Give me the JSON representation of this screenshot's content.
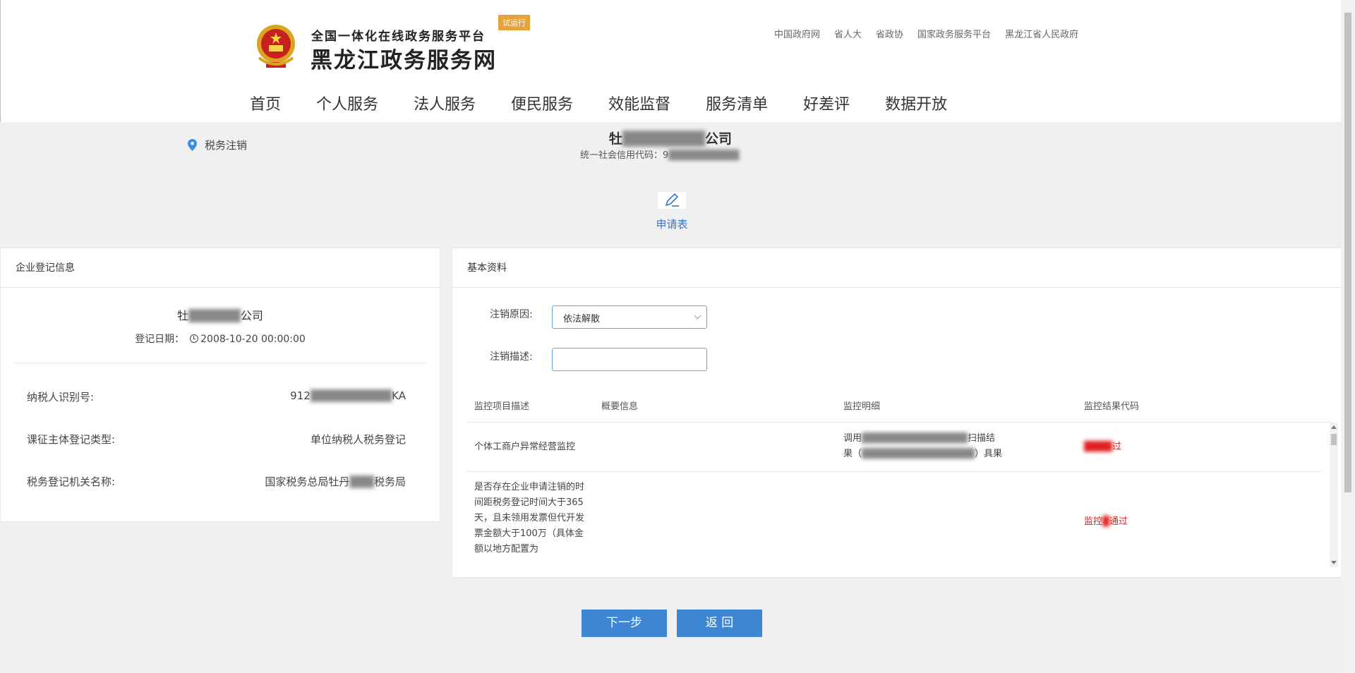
{
  "header": {
    "subtitle": "全国一体化在线政务服务平台",
    "title": "黑龙江政务服务网",
    "trial_badge": "试运行",
    "top_links": [
      "中国政府网",
      "省人大",
      "省政协",
      "国家政务服务平台",
      "黑龙江省人民政府"
    ],
    "nav": [
      "首页",
      "个人服务",
      "法人服务",
      "便民服务",
      "效能监督",
      "服务清单",
      "好差评",
      "数据开放"
    ]
  },
  "location": {
    "label": "税务注销"
  },
  "company": {
    "name_prefix": "牡",
    "name_suffix": "公司",
    "credit_code_label": "统一社会信用代码：",
    "credit_code_prefix": "9"
  },
  "step": {
    "label": "申请表"
  },
  "enterprise_panel": {
    "title": "企业登记信息",
    "name_prefix": "牡",
    "name_suffix": "公司",
    "reg_date_label": "登记日期：",
    "reg_date": "2008-10-20 00:00:00",
    "rows": [
      {
        "label": "纳税人识别号:",
        "value_prefix": "912",
        "value_suffix": "KA"
      },
      {
        "label": "课征主体登记类型:",
        "value_prefix": "单位纳税人税务登记",
        "value_suffix": ""
      },
      {
        "label": "税务登记机关名称:",
        "value_prefix": "国家税务总局牡丹",
        "value_suffix": "税务局"
      }
    ]
  },
  "basic_panel": {
    "title": "基本资料",
    "reason_label": "注销原因:",
    "reason_value": "依法解散",
    "desc_label": "注销描述:",
    "desc_value": "",
    "columns": [
      "监控项目描述",
      "概要信息",
      "监控明细",
      "监控结果代码"
    ],
    "rows": [
      {
        "desc": "个体工商户异常经营监控",
        "summary": "",
        "detail_line1": "调用",
        "detail_line1_tail": "扫描结",
        "detail_line2": "果（",
        "detail_line2_tail": "）具果",
        "result_tail": "过"
      },
      {
        "desc": "是否存在企业申请注销的时间距税务登记时间大于365天，且未领用发票但代开发票金额大于100万（具体金额以地方配置为",
        "summary": "",
        "detail": "",
        "result_head": "监控",
        "result_tail": "通过"
      }
    ]
  },
  "buttons": {
    "next": "下一步",
    "back": "返 回"
  },
  "colors": {
    "primary": "#3c86d3",
    "fail": "#e02020",
    "badge": "#e8a33b",
    "link": "#3a75c4"
  }
}
